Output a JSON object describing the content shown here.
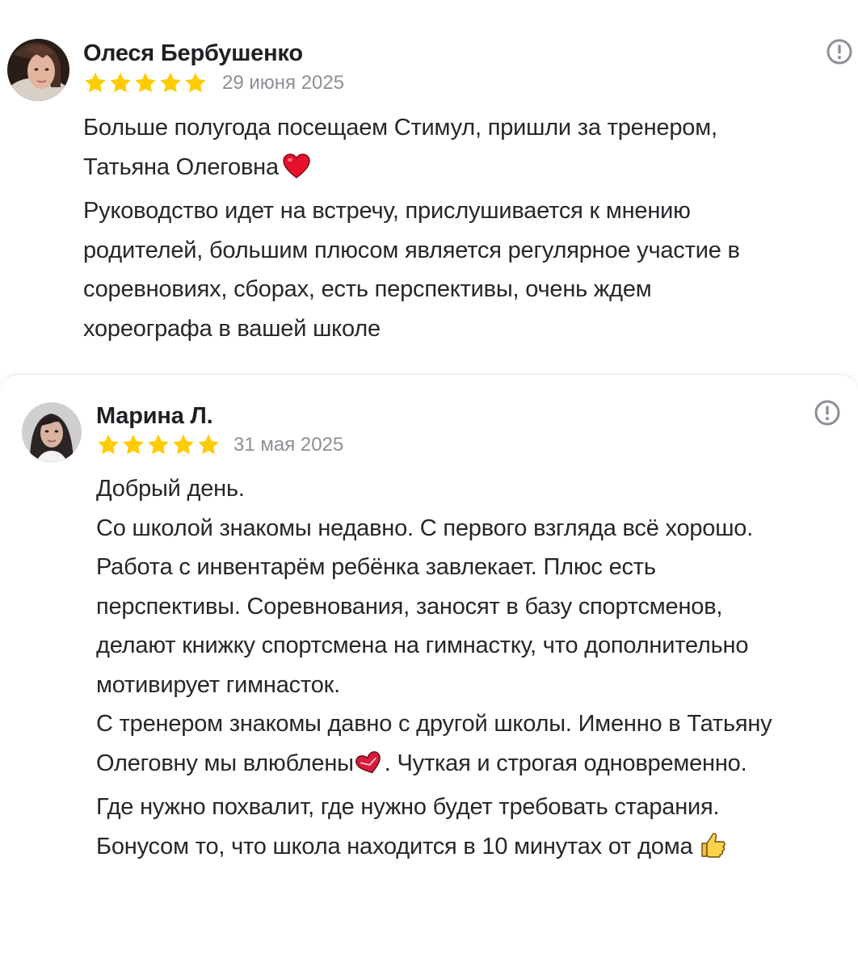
{
  "reviews": [
    {
      "author": "Олеся Бербушенко",
      "rating": 5,
      "date": "29 июня 2025",
      "text_lines": [
        "Больше полугода посещаем Стимул, пришли за тренером,",
        "Татьяна Олеговна",
        "Руководство идет на встречу, прислушивается к мнению",
        "родителей, большим плюсом является регулярное участие в",
        "соревновиях, сборах, есть перспективы, очень ждем",
        "хореографа в вашей школе"
      ],
      "emoji": "red-heart-icon"
    },
    {
      "author": "Марина Л.",
      "rating": 5,
      "date": "31 мая 2025",
      "text_lines": [
        "Добрый день.",
        "Со школой знакомы недавно. С первого взгляда всё хорошо.",
        "Работа с инвентарём ребёнка завлекает. Плюс есть",
        "перспективы. Соревнования, заносят в базу спортсменов,",
        "делают книжку спортсмена на гимнастку, что дополнительно",
        "мотивирует гимнасток.",
        "С тренером знакомы давно с другой школы. Именно в Татьяну",
        "Олеговну мы влюблены",
        ". Чуткая и строгая одновременно.",
        "Где нужно похвалит, где нужно будет требовать старания.",
        "Бонусом то, что школа находится в 10 минутах от дома"
      ],
      "emojis": [
        "love-letter-heart-icon",
        "thumbs-up-icon"
      ]
    }
  ],
  "colors": {
    "star": "#ffcc00",
    "date": "#8e8e96",
    "text": "#26262b",
    "icon": "#8e8e96"
  }
}
